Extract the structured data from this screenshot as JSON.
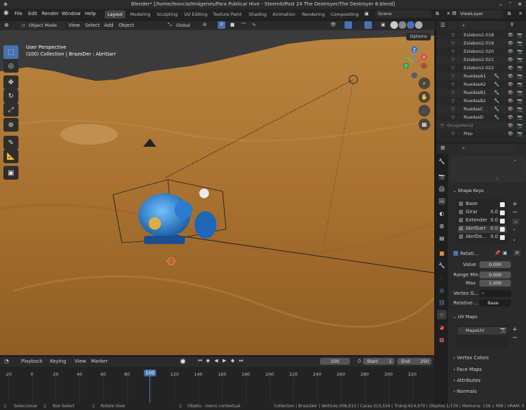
{
  "title": "Blender* [/home/leoncio/Imágenes/Para Publicar Hive - Steemit/Post 24 The Destroyer/The Destroyer 8.blend]",
  "menu": [
    "File",
    "Edit",
    "Render",
    "Window",
    "Help"
  ],
  "workspaces": [
    "Layout",
    "Modeling",
    "Sculpting",
    "UV Editing",
    "Texture Paint",
    "Shading",
    "Animation",
    "Rendering",
    "Compositing"
  ],
  "scene": "Scene",
  "viewlayer": "ViewLayer",
  "header": {
    "mode": "Object Mode",
    "view": "View",
    "select": "Select",
    "add": "Add",
    "object": "Object",
    "orientation": "Global",
    "options": "Options"
  },
  "overlay": {
    "line1": "User Perspective",
    "line2": "(100) Collection | BrazoDer : AbriGarr"
  },
  "outliner": {
    "search_placeholder": "",
    "items": [
      "Eslabon2.018",
      "Eslabon2.019",
      "Eslabon2.020",
      "Eslabon2.021",
      "Eslabon2.022",
      "RuedasA1",
      "RuedasA2",
      "RuedasB1",
      "RuedasB2",
      "RuedasC",
      "RuedasD",
      "OrugaVers2",
      "Piso"
    ]
  },
  "properties": {
    "shape_keys_title": "Shape Keys",
    "shape_keys": [
      {
        "name": "Base",
        "value": ""
      },
      {
        "name": "Girar",
        "value": "0.0"
      },
      {
        "name": "Extender",
        "value": "0.0"
      },
      {
        "name": "AbriGarr",
        "value": "0.0"
      },
      {
        "name": "AbriDe...",
        "value": "0.0"
      }
    ],
    "relative_label": "Relati...",
    "value_label": "Value",
    "value": "0.000",
    "range_min_label": "Range Min",
    "range_min": "0.000",
    "max_label": "Max",
    "max": "1.000",
    "vertex_group_label": "Vertex G...",
    "relative_to_label": "Relative ...",
    "relative_to": "Base",
    "uv_maps_title": "UV Maps",
    "uv_map": "MapaUV",
    "vertex_colors": "Vertex Colors",
    "face_maps": "Face Maps",
    "attributes": "Attributes",
    "normals": "Normals"
  },
  "timeline": {
    "playback": "Playback",
    "keying": "Keying",
    "view": "View",
    "marker": "Marker",
    "current_frame": "100",
    "start_label": "Start",
    "start": "1",
    "end_label": "End",
    "end": "250",
    "ticks": [
      "-20",
      "0",
      "20",
      "40",
      "60",
      "80",
      "100",
      "120",
      "140",
      "160",
      "180",
      "200",
      "220",
      "240",
      "260",
      "280",
      "300",
      "320"
    ]
  },
  "statusbar": {
    "select": "Seleccionar",
    "box_select": "Box Select",
    "rotate_view": "Rotate View",
    "context_menu": "Objeto - menú contextual",
    "stats": "Collection | BrazoDer | Vértices:308,613 | Caras:310,534 | Triáng:614,979 | Objetos:1/159 | Memoria: 158.1 MiB | VRAM: 0"
  },
  "colors": {
    "accent": "#4772b3",
    "sand": "#b27c38",
    "header": "#2a2a2a",
    "panel": "#303030"
  }
}
